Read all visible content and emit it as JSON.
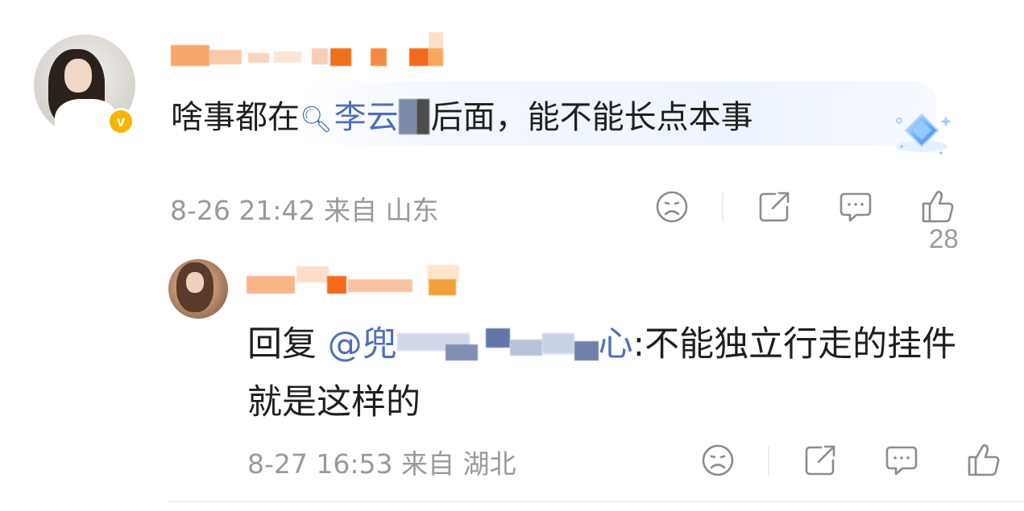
{
  "comment": {
    "text_before": "啥事都在",
    "topic_icon": "search-icon",
    "topic_name": "李云",
    "text_after": "后面，能不能长点本事",
    "time": "8-26 21:42",
    "source_label": "来自",
    "location": "山东",
    "like_count": "28",
    "verified_badge": "v"
  },
  "reply": {
    "reply_label": "回复",
    "at_symbol": "@",
    "mention_visible": "兜",
    "mention_tail": "心",
    "colon_text": ":不能独立行走的挂件",
    "text_line2": "就是这样的",
    "time": "8-27 16:53",
    "source_label": "来自",
    "location": "湖北"
  },
  "icons": {
    "dislike": "sad-face-icon",
    "share": "share-icon",
    "comment": "comment-bubble-icon",
    "like": "thumbs-up-icon",
    "decoration": "diamond-badge-icon"
  },
  "colors": {
    "link": "#4f6fb8",
    "meta": "#9a9a9a",
    "icon": "#8c8c8c",
    "vip_orange": "#f47a20",
    "verified": "#f7b500"
  }
}
